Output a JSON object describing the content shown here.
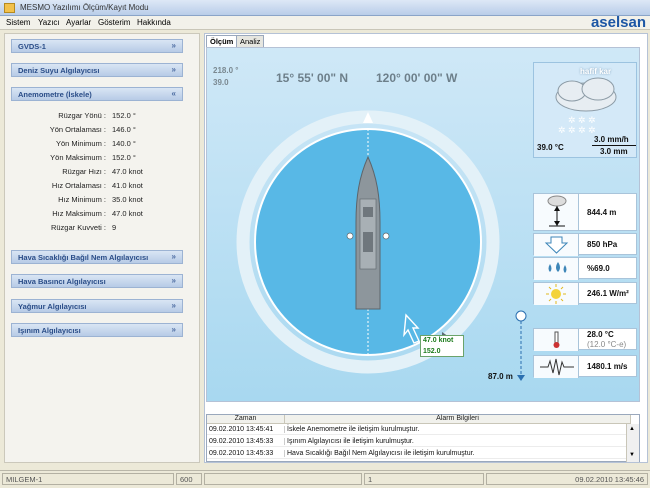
{
  "window": {
    "title": "MESMO Yazılımı Ölçüm/Kayıt Modu",
    "brand": "aselsan"
  },
  "menu": [
    "Sistem",
    "Yazıcı",
    "Ayarlar",
    "Gösterim",
    "Hakkında"
  ],
  "panels": {
    "gvds": "GVDS-1",
    "deniz": "Deniz Suyu Algılayıcısı",
    "anemo": "Anemometre (İskele)",
    "hava_nem": "Hava Sıcaklığı Bağıl Nem Algılayıcısı",
    "hava_basinc": "Hava Basıncı Algılayıcısı",
    "yagmur": "Yağmur Algılayıcısı",
    "isinim": "Işınım Algılayıcısı"
  },
  "anemo_rows": [
    {
      "label": "Rüzgar Yönü :",
      "value": "152.0 °"
    },
    {
      "label": "Yön Ortalaması :",
      "value": "146.0 °"
    },
    {
      "label": "Yön Minimum :",
      "value": "140.0 °"
    },
    {
      "label": "Yön Maksimum :",
      "value": "152.0 °"
    },
    {
      "label": "Rüzgar Hızı :",
      "value": "47.0 knot"
    },
    {
      "label": "Hız Ortalaması :",
      "value": "41.0 knot"
    },
    {
      "label": "Hız Minimum :",
      "value": "35.0 knot"
    },
    {
      "label": "Hız Maksimum :",
      "value": "47.0 knot"
    },
    {
      "label": "Rüzgar Kuvveti :",
      "value": "9"
    }
  ],
  "tabs": {
    "olcum": "Ölçüm",
    "analiz": "Analiz"
  },
  "heading": {
    "value1": "218.0 °",
    "value2": "39.0",
    "lat": "15° 55' 00\" N",
    "lon": "120° 00' 00\" W"
  },
  "wind": {
    "speed": "47.0 knot",
    "dir": "152.0"
  },
  "weather": {
    "condition": "hafif kar",
    "temp": "39.0 °C",
    "rate": "3.0 mm/h",
    "amount": "3.0 mm"
  },
  "readings": {
    "altitude": "844.4 m",
    "pressure": "850 hPa",
    "humidity": "%69.0",
    "radiation": "246.1 W/m²",
    "sea_temp": "28.0 °C",
    "sea_temp_sub": "(12.0 °C-e)",
    "sound_speed": "1480.1 m/s",
    "depth": "87.0 m"
  },
  "alarm": {
    "col_time": "Zaman",
    "col_msg": "Alarm Bilgileri",
    "rows": [
      {
        "time": "09.02.2010 13:45:41",
        "msg": "İskele Anemometre ile iletişim kurulmuştur."
      },
      {
        "time": "09.02.2010 13:45:33",
        "msg": "Işınım Algılayıcısı ile iletişim kurulmuştur."
      },
      {
        "time": "09.02.2010 13:45:33",
        "msg": "Hava Sıcaklığı Bağıl Nem Algılayıcısı ile iletişim kurulmuştur."
      }
    ]
  },
  "status": {
    "ship": "MILGEM-1",
    "code": "600",
    "page": "1",
    "datetime": "09.02.2010 13:45:46"
  }
}
